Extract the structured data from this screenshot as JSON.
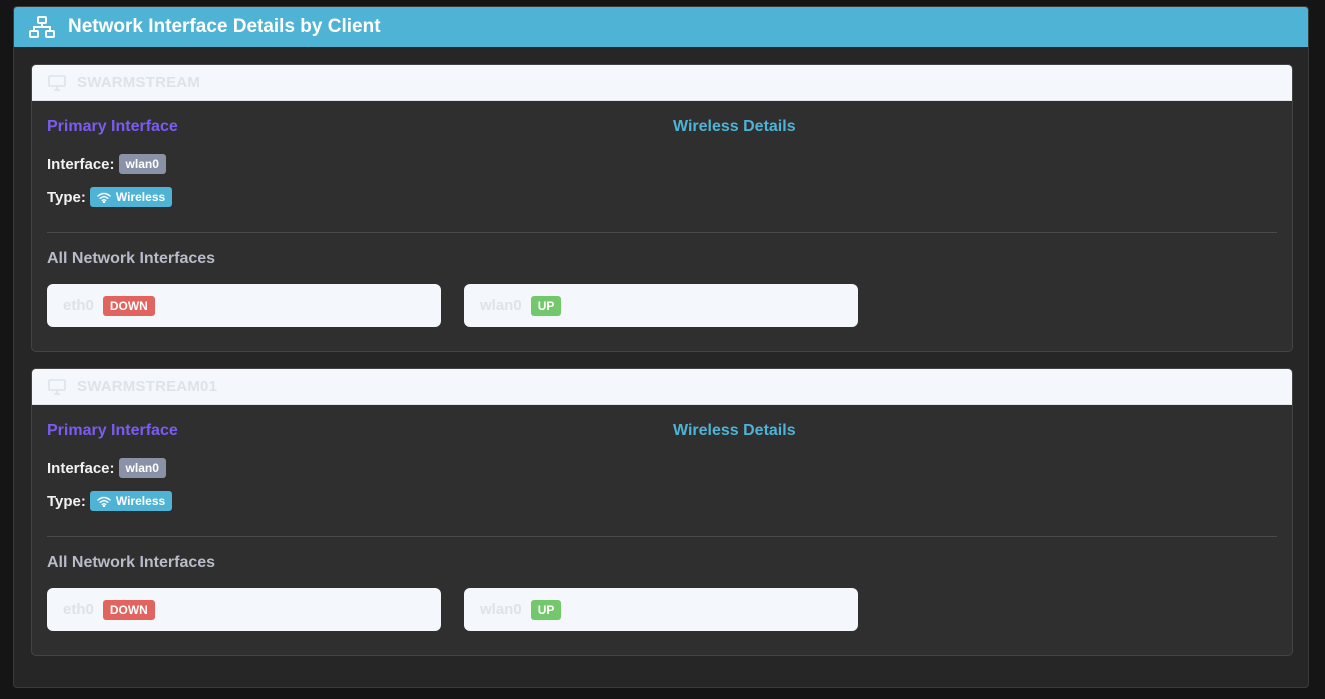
{
  "panel": {
    "title": "Network Interface Details by Client",
    "header_icon": "network-icon",
    "accent": "#4fb3d5"
  },
  "labels": {
    "primary_interface": "Primary Interface",
    "wireless_details": "Wireless Details",
    "interface": "Interface:",
    "type": "Type:",
    "all_interfaces": "All Network Interfaces"
  },
  "clients": [
    {
      "name": "SWARMSTREAM",
      "icon": "monitor-icon",
      "primary_interface": "wlan0",
      "type": "Wireless",
      "interfaces": [
        {
          "name": "eth0",
          "status": "DOWN"
        },
        {
          "name": "wlan0",
          "status": "UP"
        }
      ]
    },
    {
      "name": "SWARMSTREAM01",
      "icon": "monitor-icon",
      "primary_interface": "wlan0",
      "type": "Wireless",
      "interfaces": [
        {
          "name": "eth0",
          "status": "DOWN"
        },
        {
          "name": "wlan0",
          "status": "UP"
        }
      ]
    }
  ],
  "colors": {
    "primary_title": "#7c5cf0",
    "wireless_title": "#4fb3d5",
    "status_down": "#e2645f",
    "status_up": "#74c86b"
  }
}
